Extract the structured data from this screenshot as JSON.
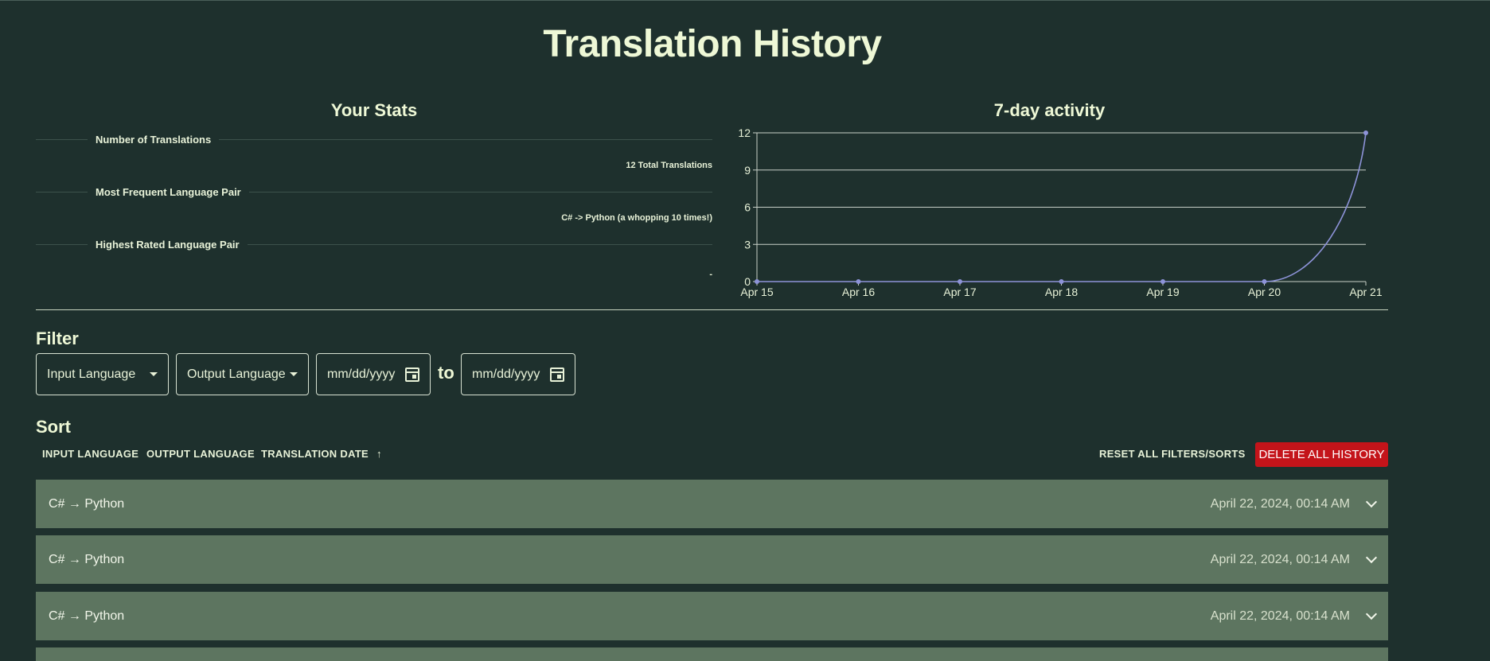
{
  "page_title": "Translation History",
  "stats": {
    "title": "Your Stats",
    "items": [
      {
        "label": "Number of Translations",
        "value": "12 Total Translations"
      },
      {
        "label": "Most Frequent Language Pair",
        "value": "C# -> Python (a whopping 10 times!)"
      },
      {
        "label": "Highest Rated Language Pair",
        "value": "-"
      }
    ]
  },
  "chart": {
    "title": "7-day activity"
  },
  "chart_data": {
    "type": "line",
    "title": "7-day activity",
    "categories": [
      "Apr 15",
      "Apr 16",
      "Apr 17",
      "Apr 18",
      "Apr 19",
      "Apr 20",
      "Apr 21"
    ],
    "values": [
      0,
      0,
      0,
      0,
      0,
      0,
      12
    ],
    "yticks": [
      "0",
      "3",
      "6",
      "9",
      "12"
    ],
    "ylim": [
      0,
      12
    ],
    "grid": true,
    "color": "#8d93d8"
  },
  "filter": {
    "heading": "Filter",
    "input_language": "Input Language",
    "output_language": "Output Language",
    "date_from_placeholder": "mm/dd/yyyy",
    "date_to_placeholder": "mm/dd/yyyy",
    "to_label": "to"
  },
  "sort": {
    "heading": "Sort",
    "input_language": "INPUT LANGUAGE",
    "output_language": "OUTPUT LANGUAGE",
    "translation_date": "TRANSLATION DATE",
    "translation_date_arrow": "↑",
    "reset": "RESET ALL FILTERS/SORTS",
    "delete_all": "DELETE ALL HISTORY"
  },
  "history": [
    {
      "pair": "C# → Python",
      "date": "April 22, 2024, 00:14 AM"
    },
    {
      "pair": "C# → Python",
      "date": "April 22, 2024, 00:14 AM"
    },
    {
      "pair": "C# → Python",
      "date": "April 22, 2024, 00:14 AM"
    },
    {
      "pair": "",
      "date": ""
    }
  ],
  "colors": {
    "background": "#1e302d",
    "row": "#5d7560",
    "delete": "#c4141a",
    "accent_text": "#eef8d6"
  }
}
